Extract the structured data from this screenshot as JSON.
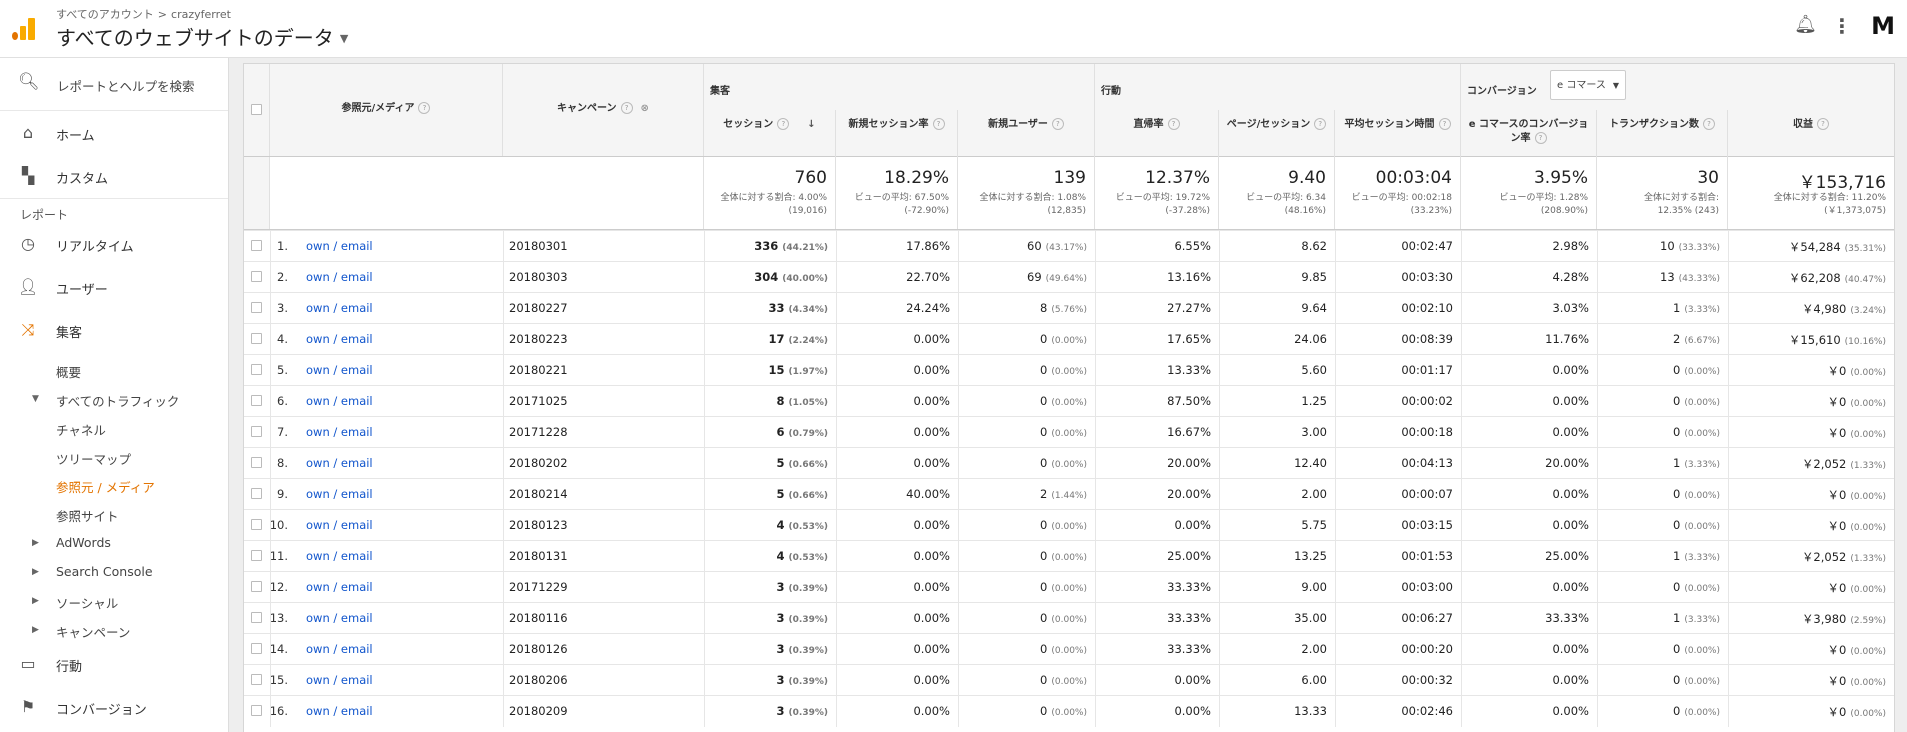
{
  "header": {
    "breadcrumb": [
      "すべてのアカウント",
      "crazyferret"
    ],
    "breadcrumb_sep": ">",
    "view_title": "すべてのウェブサイトのデータ",
    "avatar": "M"
  },
  "sidebar": {
    "search_placeholder": "レポートとヘルプを検索",
    "home": "ホーム",
    "custom": "カスタム",
    "reports_label": "レポート",
    "realtime": "リアルタイム",
    "users": "ユーザー",
    "acquisition": "集客",
    "acq_sub": {
      "overview": "概要",
      "all_traffic": "すべてのトラフィック",
      "channels": "チャネル",
      "treemap": "ツリーマップ",
      "source_medium": "参照元 / メディア",
      "referrals": "参照サイト",
      "adwords": "AdWords",
      "search_console": "Search Console",
      "social": "ソーシャル",
      "campaigns": "キャンペーン"
    },
    "behavior": "行動",
    "conversions": "コンバージョン"
  },
  "table": {
    "col_source": "参照元/メディア",
    "col_campaign": "キャンペーン",
    "group_acq": "集客",
    "group_beh": "行動",
    "group_conv": "コンバージョン",
    "conv_select": "e コマース",
    "cols": [
      "セッション",
      "新規セッション率",
      "新規ユーザー",
      "直帰率",
      "ページ/セッション",
      "平均セッション時間",
      "e コマースのコンバージョン率",
      "トランザクション数",
      "収益"
    ],
    "totals": [
      {
        "big": "760",
        "sub": [
          "全体に対する割合: 4.00%",
          "(19,016)"
        ]
      },
      {
        "big": "18.29%",
        "sub": [
          "ビューの平均: 67.50%",
          "(-72.90%)"
        ]
      },
      {
        "big": "139",
        "sub": [
          "全体に対する割合: 1.08%",
          "(12,835)"
        ]
      },
      {
        "big": "12.37%",
        "sub": [
          "ビューの平均: 19.72%",
          "(-37.28%)"
        ]
      },
      {
        "big": "9.40",
        "sub": [
          "ビューの平均: 6.34",
          "(48.16%)"
        ]
      },
      {
        "big": "00:03:04",
        "sub": [
          "ビューの平均: 00:02:18",
          "(33.23%)"
        ]
      },
      {
        "big": "3.95%",
        "sub": [
          "ビューの平均: 1.28%",
          "(208.90%)"
        ]
      },
      {
        "big": "30",
        "sub": [
          "全体に対する割合:",
          "12.35% (243)"
        ]
      },
      {
        "big": "￥153,716",
        "sub": [
          "全体に対する割合: 11.20%",
          "(￥1,373,075)"
        ]
      }
    ],
    "rows": [
      {
        "rank": "1.",
        "src": "own / email",
        "camp": "20180301",
        "s": "336",
        "sp": "(44.21%)",
        "nsr": "17.86%",
        "nu": "60",
        "nup": "(43.17%)",
        "br": "6.55%",
        "pps": "8.62",
        "asd": "00:02:47",
        "ecr": "2.98%",
        "tx": "10",
        "txp": "(33.33%)",
        "rev": "￥54,284",
        "revp": "(35.31%)"
      },
      {
        "rank": "2.",
        "src": "own / email",
        "camp": "20180303",
        "s": "304",
        "sp": "(40.00%)",
        "nsr": "22.70%",
        "nu": "69",
        "nup": "(49.64%)",
        "br": "13.16%",
        "pps": "9.85",
        "asd": "00:03:30",
        "ecr": "4.28%",
        "tx": "13",
        "txp": "(43.33%)",
        "rev": "￥62,208",
        "revp": "(40.47%)"
      },
      {
        "rank": "3.",
        "src": "own / email",
        "camp": "20180227",
        "s": "33",
        "sp": "(4.34%)",
        "nsr": "24.24%",
        "nu": "8",
        "nup": "(5.76%)",
        "br": "27.27%",
        "pps": "9.64",
        "asd": "00:02:10",
        "ecr": "3.03%",
        "tx": "1",
        "txp": "(3.33%)",
        "rev": "￥4,980",
        "revp": "(3.24%)"
      },
      {
        "rank": "4.",
        "src": "own / email",
        "camp": "20180223",
        "s": "17",
        "sp": "(2.24%)",
        "nsr": "0.00%",
        "nu": "0",
        "nup": "(0.00%)",
        "br": "17.65%",
        "pps": "24.06",
        "asd": "00:08:39",
        "ecr": "11.76%",
        "tx": "2",
        "txp": "(6.67%)",
        "rev": "￥15,610",
        "revp": "(10.16%)"
      },
      {
        "rank": "5.",
        "src": "own / email",
        "camp": "20180221",
        "s": "15",
        "sp": "(1.97%)",
        "nsr": "0.00%",
        "nu": "0",
        "nup": "(0.00%)",
        "br": "13.33%",
        "pps": "5.60",
        "asd": "00:01:17",
        "ecr": "0.00%",
        "tx": "0",
        "txp": "(0.00%)",
        "rev": "￥0",
        "revp": "(0.00%)"
      },
      {
        "rank": "6.",
        "src": "own / email",
        "camp": "20171025",
        "s": "8",
        "sp": "(1.05%)",
        "nsr": "0.00%",
        "nu": "0",
        "nup": "(0.00%)",
        "br": "87.50%",
        "pps": "1.25",
        "asd": "00:00:02",
        "ecr": "0.00%",
        "tx": "0",
        "txp": "(0.00%)",
        "rev": "￥0",
        "revp": "(0.00%)"
      },
      {
        "rank": "7.",
        "src": "own / email",
        "camp": "20171228",
        "s": "6",
        "sp": "(0.79%)",
        "nsr": "0.00%",
        "nu": "0",
        "nup": "(0.00%)",
        "br": "16.67%",
        "pps": "3.00",
        "asd": "00:00:18",
        "ecr": "0.00%",
        "tx": "0",
        "txp": "(0.00%)",
        "rev": "￥0",
        "revp": "(0.00%)"
      },
      {
        "rank": "8.",
        "src": "own / email",
        "camp": "20180202",
        "s": "5",
        "sp": "(0.66%)",
        "nsr": "0.00%",
        "nu": "0",
        "nup": "(0.00%)",
        "br": "20.00%",
        "pps": "12.40",
        "asd": "00:04:13",
        "ecr": "20.00%",
        "tx": "1",
        "txp": "(3.33%)",
        "rev": "￥2,052",
        "revp": "(1.33%)"
      },
      {
        "rank": "9.",
        "src": "own / email",
        "camp": "20180214",
        "s": "5",
        "sp": "(0.66%)",
        "nsr": "40.00%",
        "nu": "2",
        "nup": "(1.44%)",
        "br": "20.00%",
        "pps": "2.00",
        "asd": "00:00:07",
        "ecr": "0.00%",
        "tx": "0",
        "txp": "(0.00%)",
        "rev": "￥0",
        "revp": "(0.00%)"
      },
      {
        "rank": "10.",
        "src": "own / email",
        "camp": "20180123",
        "s": "4",
        "sp": "(0.53%)",
        "nsr": "0.00%",
        "nu": "0",
        "nup": "(0.00%)",
        "br": "0.00%",
        "pps": "5.75",
        "asd": "00:03:15",
        "ecr": "0.00%",
        "tx": "0",
        "txp": "(0.00%)",
        "rev": "￥0",
        "revp": "(0.00%)"
      },
      {
        "rank": "11.",
        "src": "own / email",
        "camp": "20180131",
        "s": "4",
        "sp": "(0.53%)",
        "nsr": "0.00%",
        "nu": "0",
        "nup": "(0.00%)",
        "br": "25.00%",
        "pps": "13.25",
        "asd": "00:01:53",
        "ecr": "25.00%",
        "tx": "1",
        "txp": "(3.33%)",
        "rev": "￥2,052",
        "revp": "(1.33%)"
      },
      {
        "rank": "12.",
        "src": "own / email",
        "camp": "20171229",
        "s": "3",
        "sp": "(0.39%)",
        "nsr": "0.00%",
        "nu": "0",
        "nup": "(0.00%)",
        "br": "33.33%",
        "pps": "9.00",
        "asd": "00:03:00",
        "ecr": "0.00%",
        "tx": "0",
        "txp": "(0.00%)",
        "rev": "￥0",
        "revp": "(0.00%)"
      },
      {
        "rank": "13.",
        "src": "own / email",
        "camp": "20180116",
        "s": "3",
        "sp": "(0.39%)",
        "nsr": "0.00%",
        "nu": "0",
        "nup": "(0.00%)",
        "br": "33.33%",
        "pps": "35.00",
        "asd": "00:06:27",
        "ecr": "33.33%",
        "tx": "1",
        "txp": "(3.33%)",
        "rev": "￥3,980",
        "revp": "(2.59%)"
      },
      {
        "rank": "14.",
        "src": "own / email",
        "camp": "20180126",
        "s": "3",
        "sp": "(0.39%)",
        "nsr": "0.00%",
        "nu": "0",
        "nup": "(0.00%)",
        "br": "33.33%",
        "pps": "2.00",
        "asd": "00:00:20",
        "ecr": "0.00%",
        "tx": "0",
        "txp": "(0.00%)",
        "rev": "￥0",
        "revp": "(0.00%)"
      },
      {
        "rank": "15.",
        "src": "own / email",
        "camp": "20180206",
        "s": "3",
        "sp": "(0.39%)",
        "nsr": "0.00%",
        "nu": "0",
        "nup": "(0.00%)",
        "br": "0.00%",
        "pps": "6.00",
        "asd": "00:00:32",
        "ecr": "0.00%",
        "tx": "0",
        "txp": "(0.00%)",
        "rev": "￥0",
        "revp": "(0.00%)"
      },
      {
        "rank": "16.",
        "src": "own / email",
        "camp": "20180209",
        "s": "3",
        "sp": "(0.39%)",
        "nsr": "0.00%",
        "nu": "0",
        "nup": "(0.00%)",
        "br": "0.00%",
        "pps": "13.33",
        "asd": "00:02:46",
        "ecr": "0.00%",
        "tx": "0",
        "txp": "(0.00%)",
        "rev": "￥0",
        "revp": "(0.00%)"
      }
    ]
  }
}
